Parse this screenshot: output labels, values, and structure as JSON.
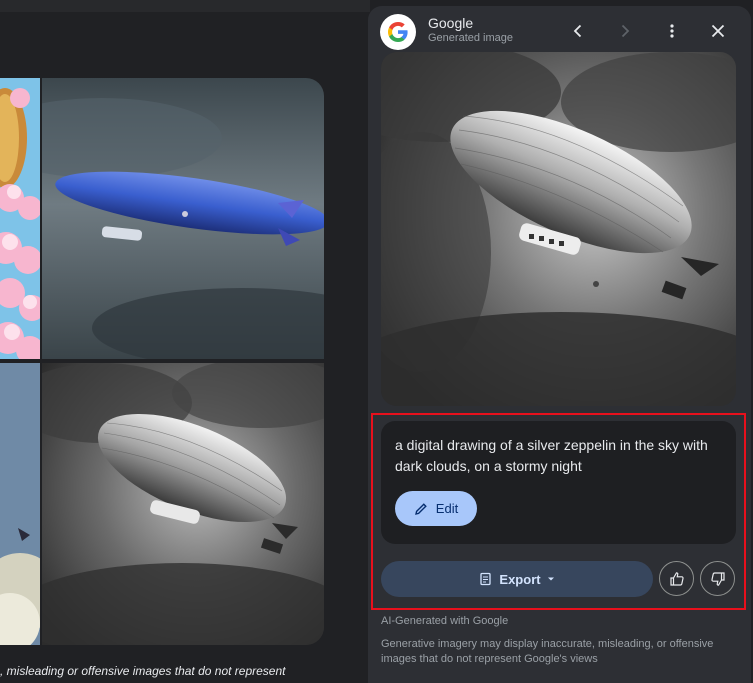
{
  "panel": {
    "title": "Google",
    "subtitle": "Generated image",
    "prompt": "a digital drawing of a silver zeppelin in the sky with dark clouds, on a stormy night",
    "edit_label": "Edit",
    "export_label": "Export",
    "ai_generated": "AI-Generated with Google",
    "disclaimer": "Generative imagery may display inaccurate, misleading, or offensive images that do not represent Google's views"
  },
  "left": {
    "disclaimer": ", misleading or offensive images that do not represent"
  },
  "colors": {
    "accent_edit": "#a8c7fa",
    "export_bg": "#37465d",
    "highlight": "#e8101c",
    "panel_bg": "#2d2f34"
  },
  "icons": [
    "google-logo-icon",
    "chevron-left-icon",
    "chevron-right-icon",
    "more-vert-icon",
    "close-icon",
    "pencil-icon",
    "export-doc-icon",
    "caret-down-icon",
    "thumbs-up-icon",
    "thumbs-down-icon"
  ]
}
